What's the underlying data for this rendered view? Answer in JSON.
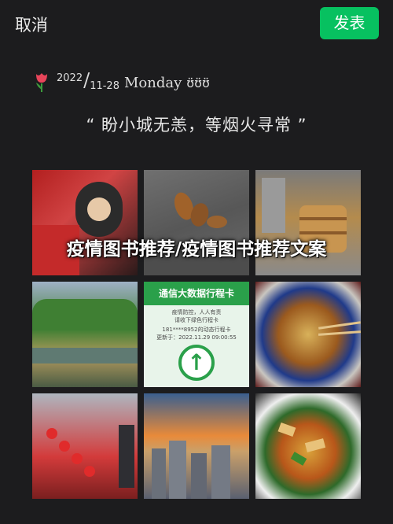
{
  "topbar": {
    "cancel_label": "取消",
    "publish_label": "发表",
    "publish_color": "#07c160"
  },
  "header": {
    "icon": "tulip-icon",
    "year": "2022",
    "month_day": "11-28",
    "weekday": "Monday",
    "emoticon": "ʊ̈ʊ̈ʊ̈"
  },
  "post": {
    "quote": "“ 盼小城无恙，等烟火寻常 ”",
    "overlay_title": "疫情图书推荐/疫情图书推荐文案"
  },
  "grid": {
    "photos": [
      {
        "icon": "photo-selfie"
      },
      {
        "icon": "photo-leaves"
      },
      {
        "icon": "photo-steamer"
      },
      {
        "icon": "photo-park"
      },
      {
        "icon": "photo-travel-card"
      },
      {
        "icon": "photo-noodles"
      },
      {
        "icon": "photo-candied-haws"
      },
      {
        "icon": "photo-sunset"
      },
      {
        "icon": "photo-stir-fry"
      }
    ],
    "travel_card": {
      "title": "通信大数据行程卡",
      "line1": "疫情防控，人人有责",
      "line2": "请收下绿色行程卡",
      "line3": "181****8952的动态行程卡",
      "line4": "更新于：2022.11.29 09:00:55"
    }
  }
}
